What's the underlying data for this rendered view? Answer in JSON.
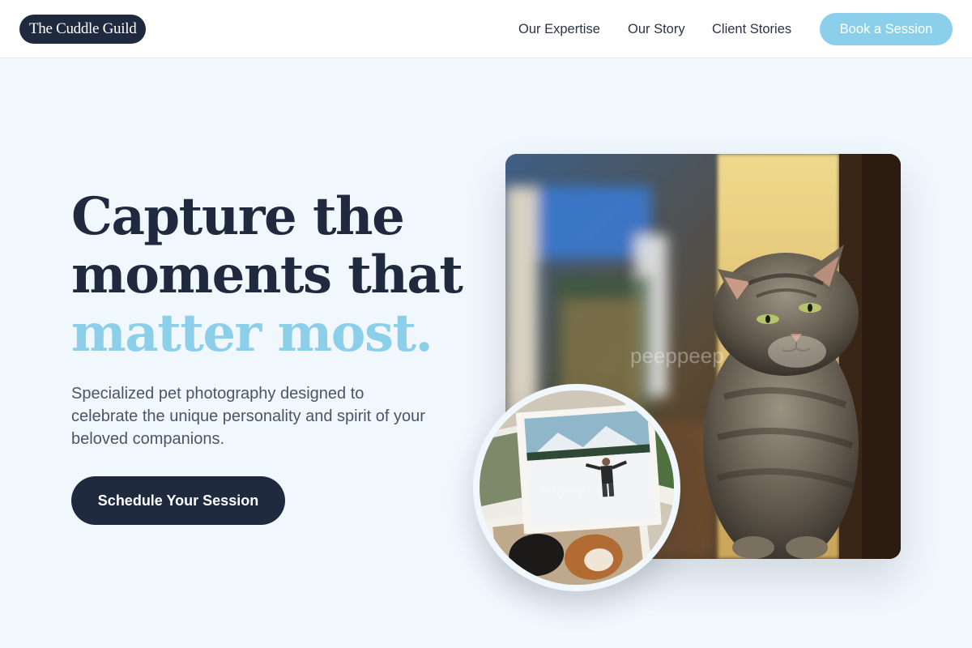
{
  "brand": {
    "name": "The Cuddle Guild"
  },
  "nav": {
    "items": [
      {
        "label": "Our Expertise"
      },
      {
        "label": "Our Story"
      },
      {
        "label": "Client Stories"
      }
    ],
    "cta_label": "Book a Session"
  },
  "hero": {
    "title_line1": "Capture the",
    "title_line2": "moments that",
    "title_accent": "matter most.",
    "subtitle": "Specialized pet photography designed to celebrate the unique personality and spirit of your beloved companions.",
    "cta_label": "Schedule Your Session"
  },
  "images": {
    "main_alt": "Tabby cat sitting in sunlight on a porch",
    "secondary_alt": "Scattered printed photos of a person in the snow and a dog",
    "watermark": "peeppeep"
  },
  "colors": {
    "primary": "#1f2a3f",
    "accent": "#8ccfea",
    "background": "#f0f7fd"
  }
}
